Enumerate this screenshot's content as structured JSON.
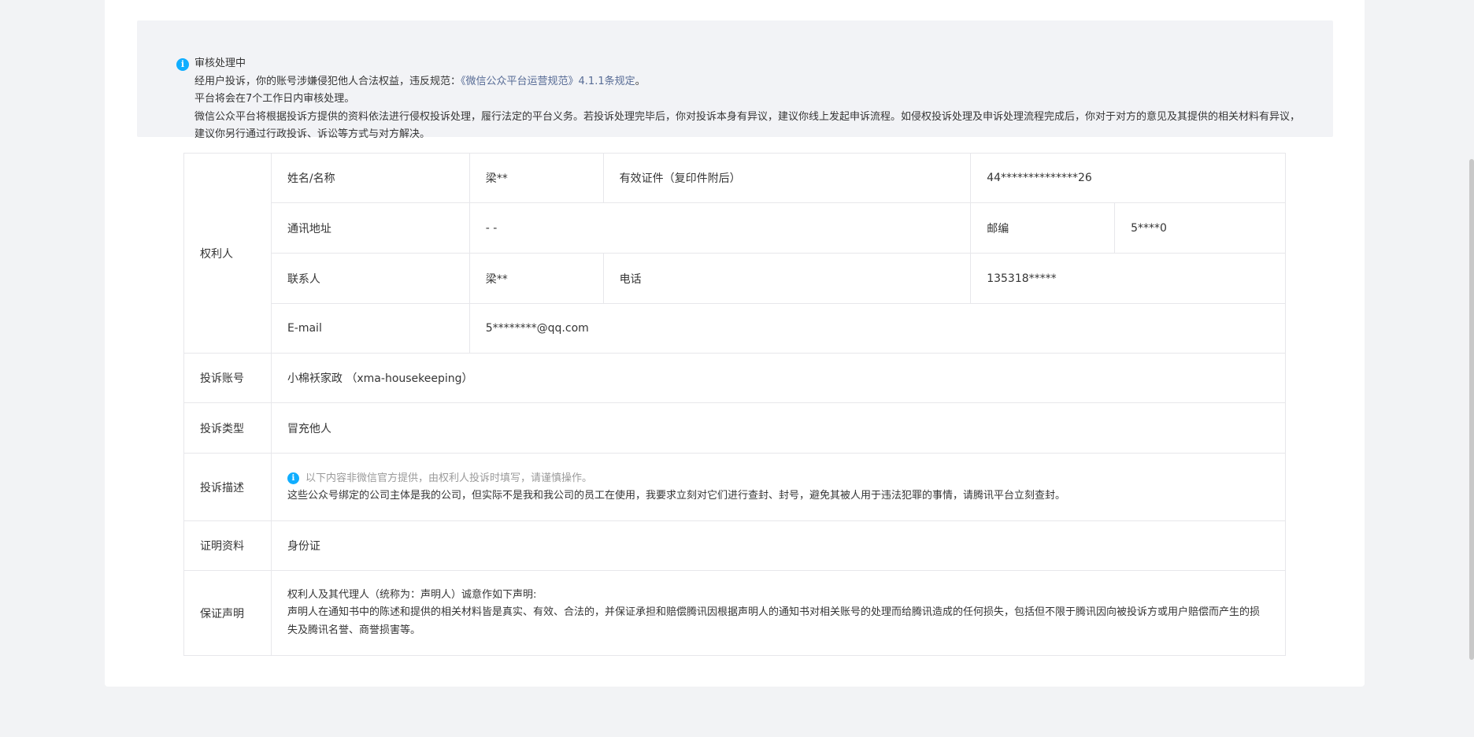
{
  "notice": {
    "status": "审核处理中",
    "line1_prefix": "经用户投诉，你的账号涉嫌侵犯他人合法权益，违反规范：",
    "line1_link": "《微信公众平台运营规范》4.1.1条规定",
    "line1_suffix": "。",
    "line2": "平台将会在7个工作日内审核处理。",
    "line3": "微信公众平台将根据投诉方提供的资料依法进行侵权投诉处理，履行法定的平台义务。若投诉处理完毕后，你对投诉本身有异议，建议你线上发起申诉流程。如侵权投诉处理及申诉处理流程完成后，你对于对方的意见及其提供的相关材料有异议，建议你另行通过行政投诉、诉讼等方式与对方解决。"
  },
  "rights_holder": {
    "section_label": "权利人",
    "name_label": "姓名/名称",
    "name_value": "梁**",
    "id_label": "有效证件（复印件附后）",
    "id_value": "44**************26",
    "address_label": "通讯地址",
    "address_value": "- -",
    "postcode_label": "邮编",
    "postcode_value": "5****0",
    "contact_label": "联系人",
    "contact_value": "梁**",
    "phone_label": "电话",
    "phone_value": "135318*****",
    "email_label": "E-mail",
    "email_value": "5********@qq.com"
  },
  "complaint": {
    "account_label": "投诉账号",
    "account_value": "小棉袄家政 （xma-housekeeping）",
    "type_label": "投诉类型",
    "type_value": "冒充他人",
    "desc_label": "投诉描述",
    "desc_tip": "以下内容非微信官方提供，由权利人投诉时填写，请谨慎操作。",
    "desc_value": "这些公众号绑定的公司主体是我的公司，但实际不是我和我公司的员工在使用，我要求立刻对它们进行查封、封号，避免其被人用于违法犯罪的事情，请腾讯平台立刻查封。",
    "proof_label": "证明资料",
    "proof_value": "身份证",
    "statement_label": "保证声明",
    "statement_line1": "权利人及其代理人（统称为：声明人）诚意作如下声明:",
    "statement_line2": "声明人在通知书中的陈述和提供的相关材料皆是真实、有效、合法的，并保证承担和赔偿腾讯因根据声明人的通知书对相关账号的处理而给腾讯造成的任何损失，包括但不限于腾讯因向被投诉方或用户赔偿而产生的损失及腾讯名誉、商誉损害等。"
  },
  "icons": {
    "info": "info-icon"
  },
  "colors": {
    "info_blue": "#10aeff",
    "link": "#576b95",
    "background": "#f2f3f5"
  }
}
